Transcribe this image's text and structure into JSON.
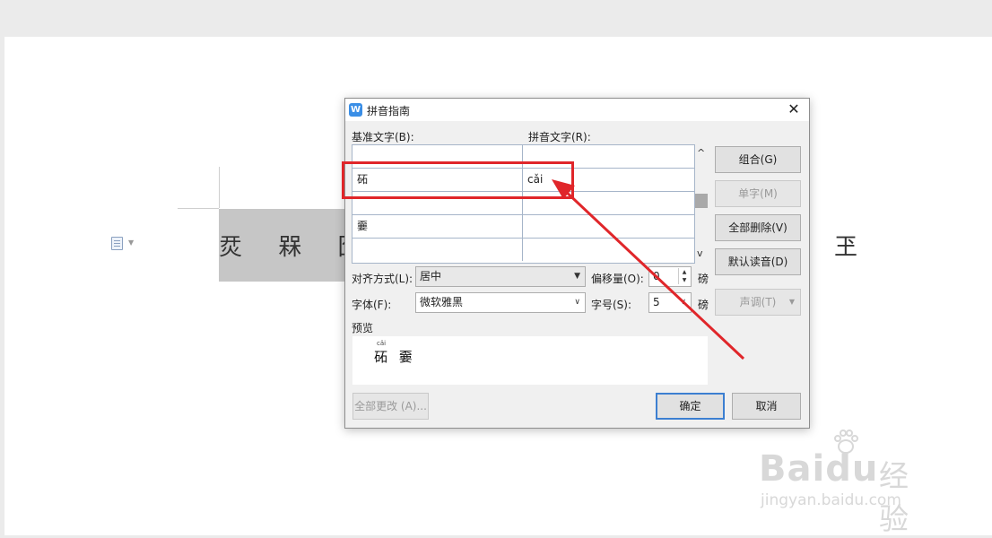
{
  "document": {
    "selected_chars": "烎 槑 囧",
    "right_char": "玊"
  },
  "dialog": {
    "title": "拼音指南",
    "app_icon_letter": "W",
    "close_label": "✕",
    "base_text_label": "基准文字(B):",
    "pinyin_text_label": "拼音文字(R):",
    "rows": [
      {
        "base": "",
        "pinyin": ""
      },
      {
        "base": "砳",
        "pinyin": "cǎi"
      },
      {
        "base": "",
        "pinyin": ""
      },
      {
        "base": "嫑",
        "pinyin": ""
      },
      {
        "base": "",
        "pinyin": ""
      }
    ],
    "scroll_up": "^",
    "scroll_down": "v",
    "buttons": {
      "combine": "组合(G)",
      "single": "单字(M)",
      "delete_all": "全部删除(V)",
      "default_reading": "默认读音(D)",
      "tone": "声调(T)",
      "change_all": "全部更改 (A)...",
      "ok": "确定",
      "cancel": "取消"
    },
    "align_label": "对齐方式(L):",
    "align_value": "居中",
    "offset_label": "偏移量(O):",
    "offset_value": "0",
    "offset_unit": "磅",
    "font_label": "字体(F):",
    "font_value": "微软雅黑",
    "size_label": "字号(S):",
    "size_value": "5",
    "size_unit": "磅",
    "preview_label": "预览",
    "preview_pinyin": "cǎi",
    "preview_text": "砳 嫑"
  },
  "watermark": {
    "brand": "Bai",
    "brand_suffix": "du",
    "cn": "经验",
    "url": "jingyan.baidu.com"
  },
  "colors": {
    "annotation_red": "#e0262a",
    "accent_blue": "#3c7fd1"
  }
}
